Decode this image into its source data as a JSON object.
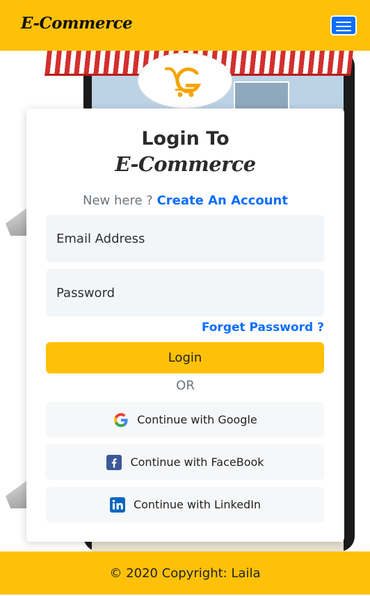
{
  "navbar": {
    "brand": "E-Commerce",
    "menu_icon": "hamburger-icon"
  },
  "hero": {
    "logo_icon": "shopping-cart-logo-icon"
  },
  "login": {
    "title": "Login To",
    "brand": "E-Commerce",
    "new_here": "New here ?",
    "create_account": "Create An Account",
    "email_placeholder": "Email Address",
    "password_placeholder": "Password",
    "forgot": "Forget Password ?",
    "login_button": "Login",
    "or": "OR",
    "social": [
      {
        "label": "Continue with Google",
        "icon": "google-icon"
      },
      {
        "label": "Continue with FaceBook",
        "icon": "facebook-icon"
      },
      {
        "label": "Continue with LinkedIn",
        "icon": "linkedin-icon"
      }
    ]
  },
  "footer": {
    "copyright": "© 2020 Copyright: Laila"
  },
  "colors": {
    "accent": "#ffc107",
    "link": "#0d6efd",
    "field_bg": "#f3f6f9"
  }
}
